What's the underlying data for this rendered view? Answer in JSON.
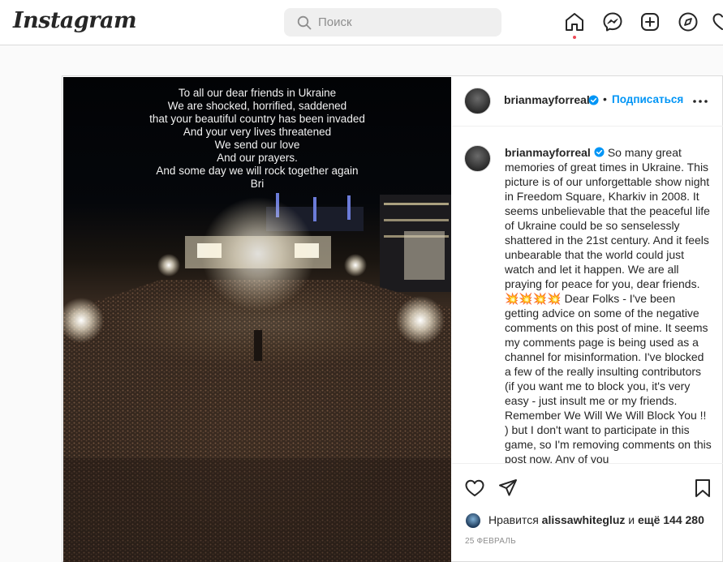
{
  "app": {
    "logo": "Instagram"
  },
  "search": {
    "placeholder": "Поиск"
  },
  "nav": {
    "icons": [
      "home-icon",
      "messenger-icon",
      "new-post-icon",
      "explore-icon"
    ]
  },
  "post": {
    "image_text": [
      "To all our dear friends in Ukraine",
      "We are shocked, horrified, saddened",
      "that your beautiful country has been invaded",
      "And your very lives threatened",
      "We send our love",
      "And our prayers.",
      "And some day we will rock together again",
      "Bri"
    ],
    "author": "brianmayforreal",
    "separator": "•",
    "follow_label": "Подписаться",
    "caption_author": "brianmayforreal",
    "caption": "So many great memories of great times in Ukraine. This picture is of our unforgettable show night in Freedom Square, Kharkiv in 2008. It seems unbelievable that the peaceful life of Ukraine could be so senselessly shattered in the 21st century. And it feels unbearable that the world could just watch and let it happen. We are all praying for peace for you, dear friends. 💥💥💥💥 Dear Folks - I've been getting advice on some of the negative comments on this post of mine. It seems my comments page is being used as a channel for misinformation. I've blocked a few of the really insulting contributors (if you want me to block you, it's very easy - just insult me or my friends. Remember We Will We Will Block You !! ) but I don't want to participate in this game, so I'm removing comments on this post now. Any of you",
    "likes_prefix": "Нравится",
    "likes_user": "alissawhitegluz",
    "likes_middle": "и",
    "likes_rest": "ещё 144 280",
    "date": "25 ФЕВРАЛЬ"
  },
  "colors": {
    "accent": "#0095f6",
    "verified": "#0095f6",
    "notification": "#ed4956"
  }
}
